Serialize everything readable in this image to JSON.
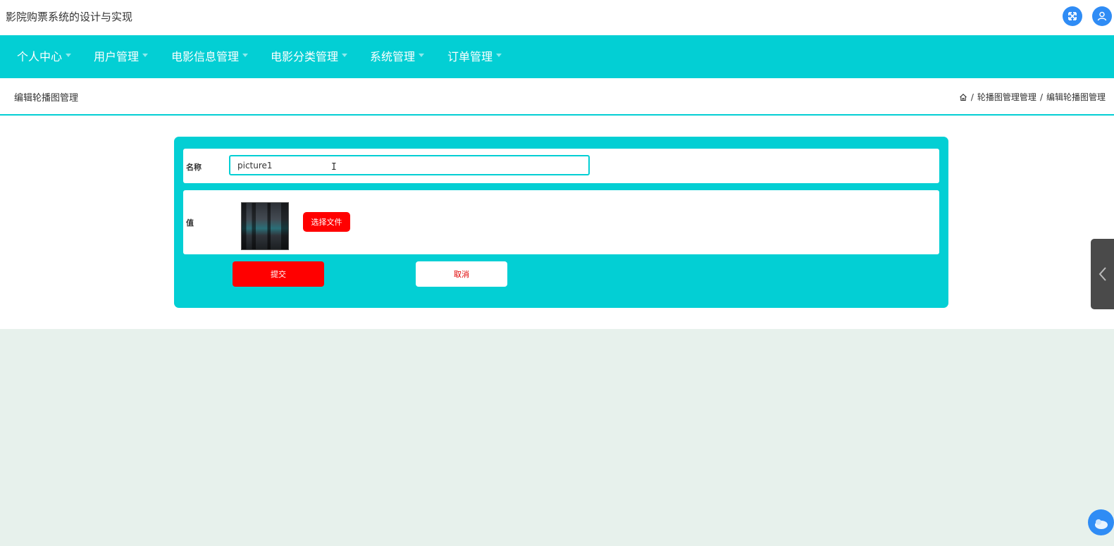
{
  "app": {
    "title": "影院购票系统的设计与实现"
  },
  "header_icons": {
    "fullscreen": "fullscreen-icon",
    "user": "user-icon"
  },
  "nav": {
    "items": [
      {
        "label": "个人中心"
      },
      {
        "label": "用户管理"
      },
      {
        "label": "电影信息管理"
      },
      {
        "label": "电影分类管理"
      },
      {
        "label": "系统管理"
      },
      {
        "label": "订单管理"
      }
    ]
  },
  "page": {
    "title": "编辑轮播图管理",
    "breadcrumb": {
      "home_icon": "home-icon",
      "sep": "/",
      "level1": "轮播图管理管理",
      "level2": "编辑轮播图管理"
    }
  },
  "form": {
    "name_label": "名称",
    "name_value": "picture1",
    "value_label": "值",
    "choose_file_label": "选择文件",
    "submit_label": "提交",
    "cancel_label": "取消"
  },
  "colors": {
    "accent": "#03cfd4",
    "danger": "#ff0000",
    "icon_blue": "#2f8cf5",
    "page_bg": "#e7f1ec"
  }
}
